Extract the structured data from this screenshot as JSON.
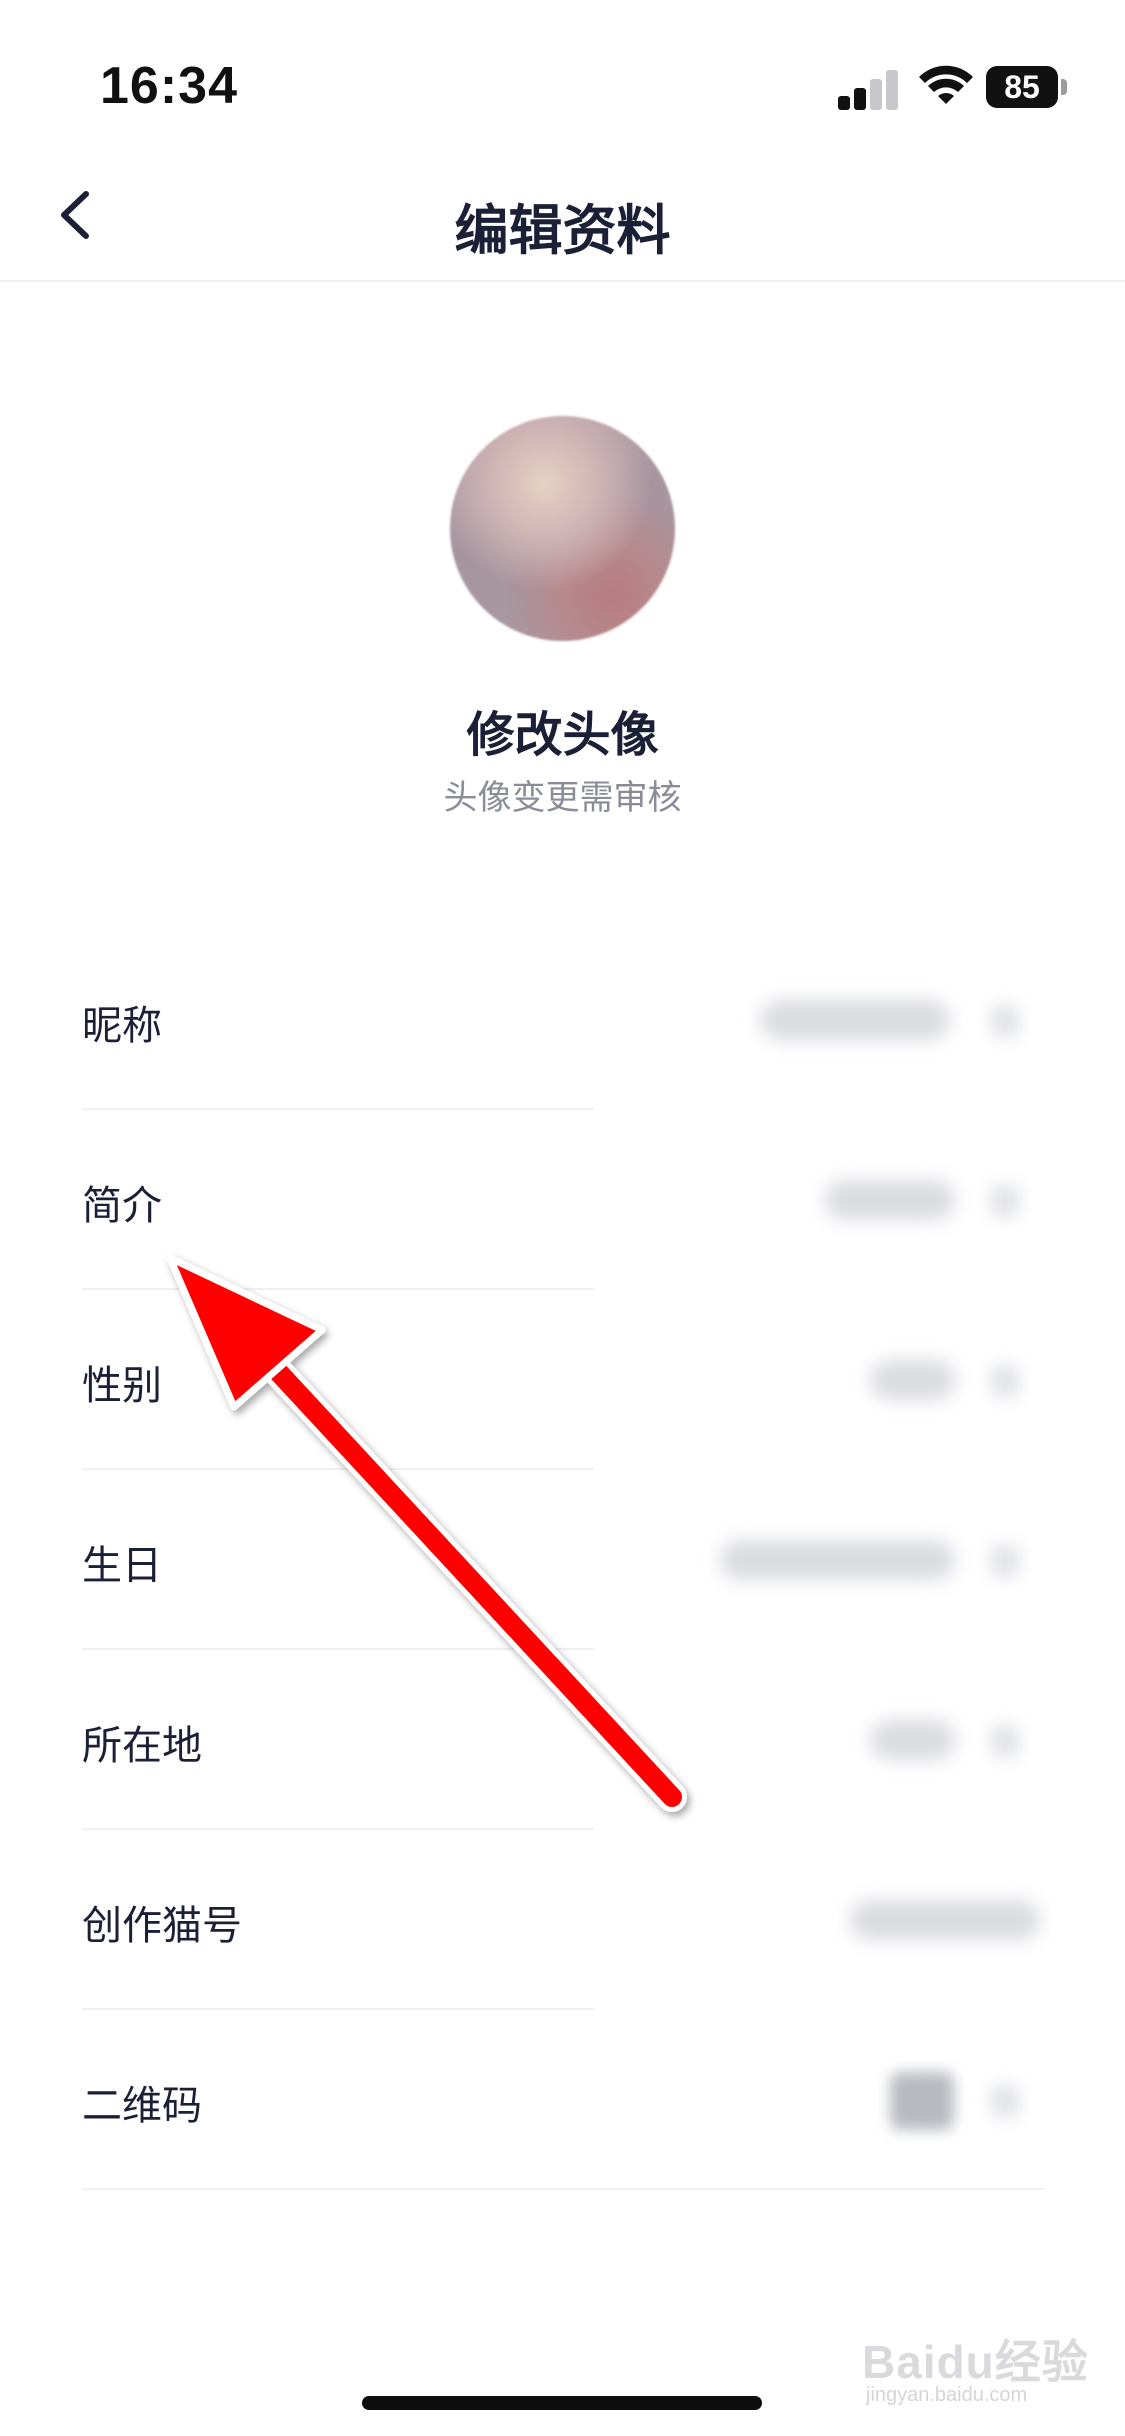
{
  "status_bar": {
    "time": "16:34",
    "battery": "85"
  },
  "nav": {
    "title": "编辑资料"
  },
  "avatar": {
    "title": "修改头像",
    "subtitle": "头像变更需审核"
  },
  "settings": {
    "items": [
      {
        "label": "昵称"
      },
      {
        "label": "简介"
      },
      {
        "label": "性别"
      },
      {
        "label": "生日"
      },
      {
        "label": "所在地"
      },
      {
        "label": "创作猫号"
      },
      {
        "label": "二维码"
      }
    ]
  },
  "annotation": {
    "arrow_color": "#ff0000",
    "arrow_target": "简介"
  },
  "watermark": {
    "text": "Baidu经验",
    "url": "jingyan.baidu.com"
  },
  "colors": {
    "text_primary": "#1c2036",
    "text_secondary": "#8a8c98",
    "divider": "#f0f0f3"
  }
}
